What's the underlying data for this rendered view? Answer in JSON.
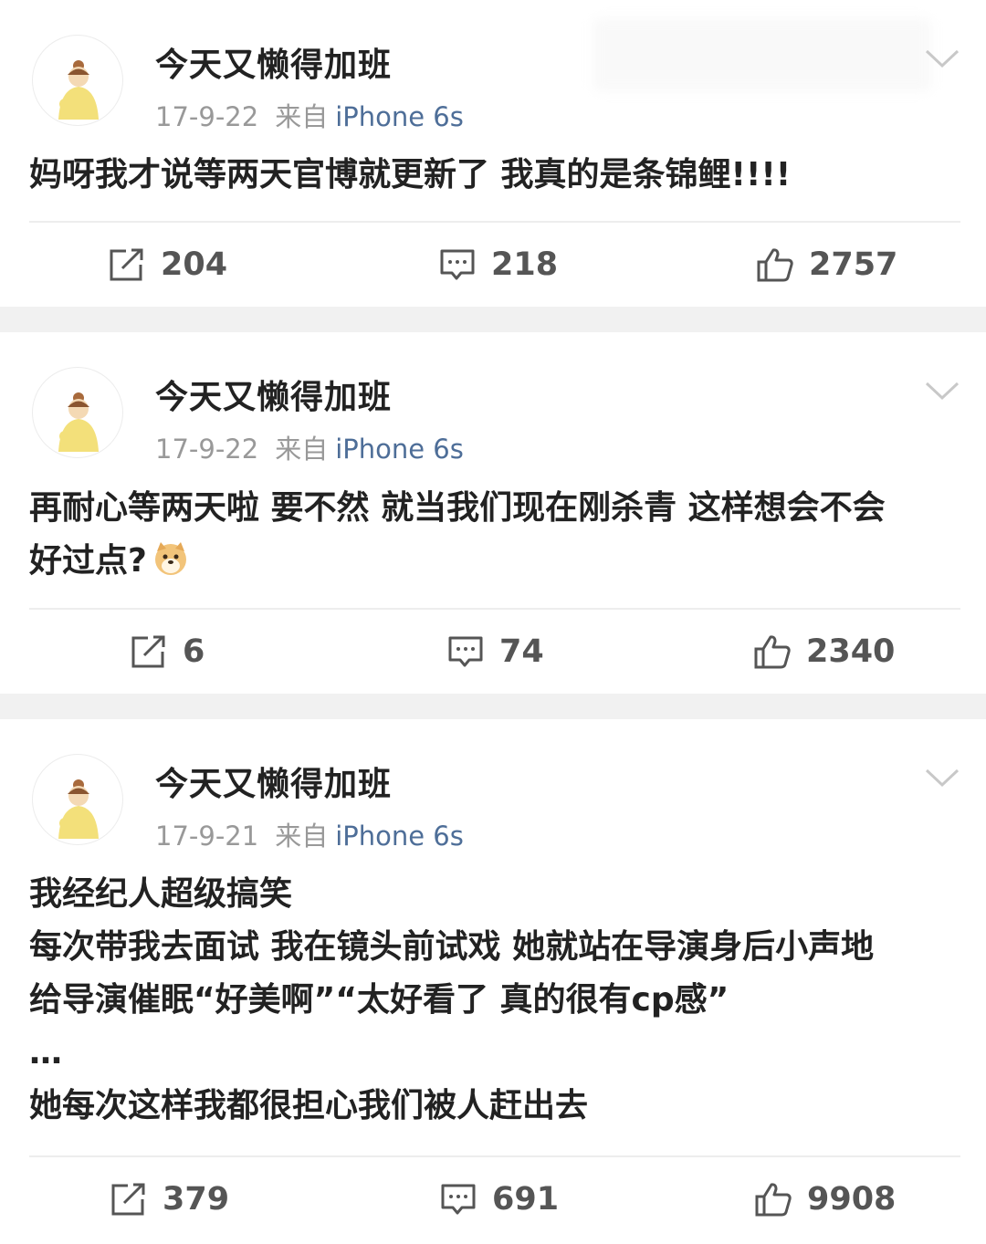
{
  "posts": [
    {
      "username": "今天又懒得加班",
      "date": "17-9-22",
      "from_label": "来自",
      "device": "iPhone 6s",
      "lines": [
        "妈呀我才说等两天官博就更新了 我真的是条锦鲤!!!!"
      ],
      "reposts": "204",
      "comments": "218",
      "likes": "2757"
    },
    {
      "username": "今天又懒得加班",
      "date": "17-9-22",
      "from_label": "来自",
      "device": "iPhone 6s",
      "lines": [
        "再耐心等两天啦 要不然 就当我们现在刚杀青 这样想会不会",
        "好过点?"
      ],
      "reposts": "6",
      "comments": "74",
      "likes": "2340"
    },
    {
      "username": "今天又懒得加班",
      "date": "17-9-21",
      "from_label": "来自",
      "device": "iPhone 6s",
      "lines": [
        "我经纪人超级搞笑",
        "每次带我去面试 我在镜头前试戏 她就站在导演身后小声地",
        "给导演催眠“好美啊”“太好看了  真的很有cp感”",
        " …",
        "她每次这样我都很担心我们被人赶出去"
      ],
      "reposts": "379",
      "comments": "691",
      "likes": "9908"
    }
  ],
  "icons": {
    "repost": "repost-icon",
    "comment": "comment-icon",
    "like": "like-icon",
    "menu": "chevron-down-icon",
    "emoji": "doge-emoji-icon"
  },
  "colors": {
    "device_link": "#4e6e98",
    "meta": "#999999",
    "separator": "#f1f1f1"
  }
}
